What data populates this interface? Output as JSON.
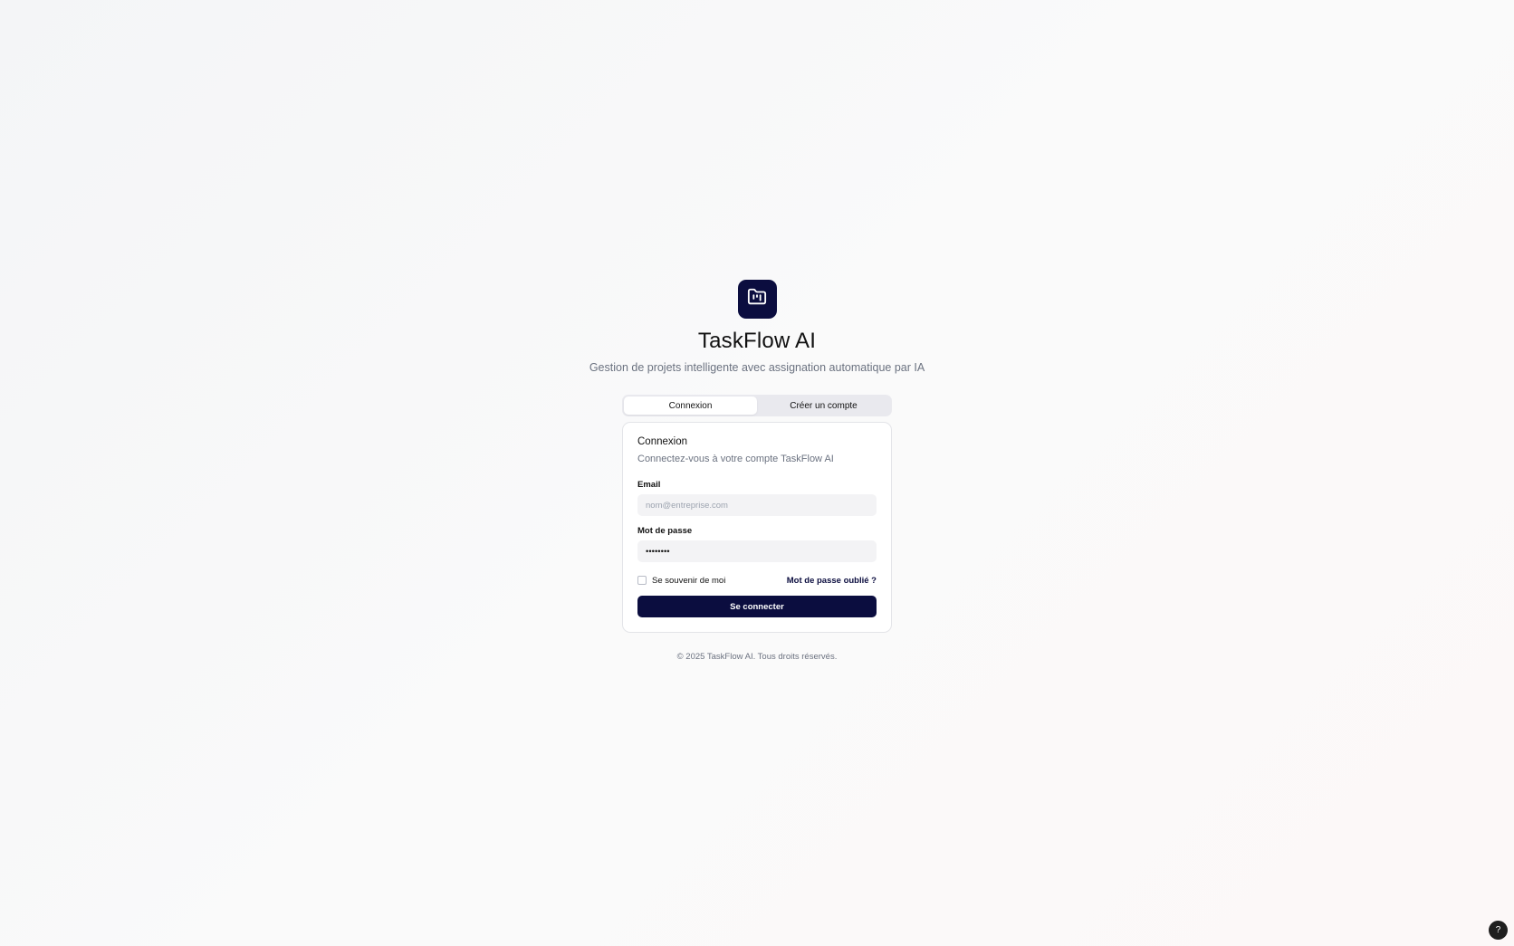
{
  "brand": {
    "logo_icon": "kanban-folder-icon",
    "title": "TaskFlow AI",
    "subtitle": "Gestion de projets intelligente avec assignation automatique par IA",
    "accent_color": "#0b0d3f"
  },
  "tabs": [
    {
      "label": "Connexion",
      "active": true
    },
    {
      "label": "Créer un compte",
      "active": false
    }
  ],
  "login_card": {
    "title": "Connexion",
    "description": "Connectez-vous à votre compte TaskFlow AI",
    "email": {
      "label": "Email",
      "placeholder": "nom@entreprise.com",
      "value": ""
    },
    "password": {
      "label": "Mot de passe",
      "value": "••••••••"
    },
    "remember_me": {
      "label": "Se souvenir de moi",
      "checked": false
    },
    "forgot_password_label": "Mot de passe oublié ?",
    "submit_label": "Se connecter"
  },
  "footer": {
    "copyright": "© 2025 TaskFlow AI. Tous droits réservés."
  },
  "help_button": {
    "label": "?",
    "icon": "help-icon"
  }
}
